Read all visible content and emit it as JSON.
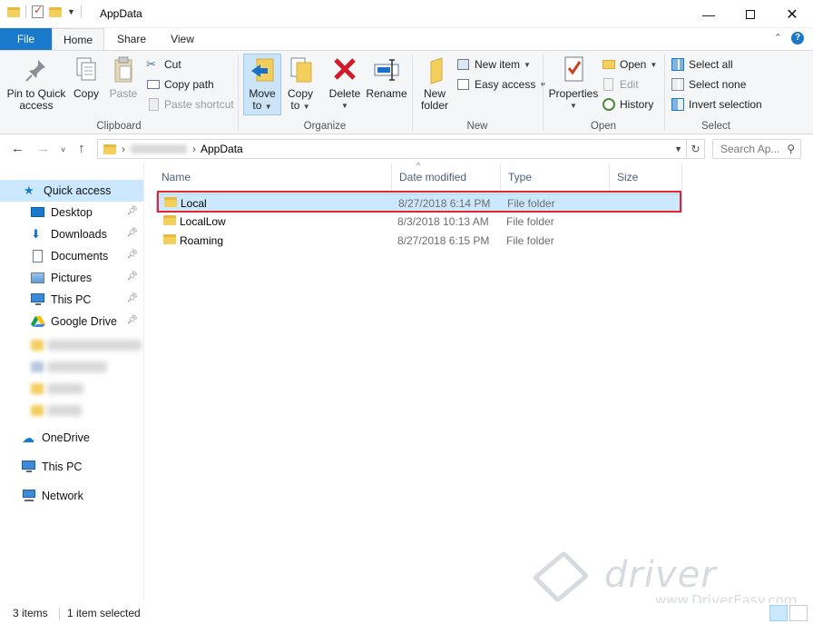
{
  "window": {
    "title": "AppData"
  },
  "ribbon_tabs": {
    "file": "File",
    "home": "Home",
    "share": "Share",
    "view": "View"
  },
  "clipboard": {
    "label": "Clipboard",
    "pin_line1": "Pin to Quick",
    "pin_line2": "access",
    "copy": "Copy",
    "paste": "Paste",
    "cut": "Cut",
    "copy_path": "Copy path",
    "paste_shortcut": "Paste shortcut"
  },
  "organize": {
    "label": "Organize",
    "move_line1": "Move",
    "move_line2": "to",
    "copy_line1": "Copy",
    "copy_line2": "to",
    "delete": "Delete",
    "rename": "Rename"
  },
  "new": {
    "label": "New",
    "folder_line1": "New",
    "folder_line2": "folder",
    "new_item": "New item",
    "easy_access": "Easy access"
  },
  "open": {
    "label": "Open",
    "properties": "Properties",
    "open": "Open",
    "edit": "Edit",
    "history": "History"
  },
  "select": {
    "label": "Select",
    "select_all": "Select all",
    "select_none": "Select none",
    "invert": "Invert selection"
  },
  "address": {
    "current": "AppData"
  },
  "search": {
    "placeholder": "Search Ap..."
  },
  "sidebar": {
    "quick_access": "Quick access",
    "items": [
      {
        "label": "Desktop"
      },
      {
        "label": "Downloads"
      },
      {
        "label": "Documents"
      },
      {
        "label": "Pictures"
      },
      {
        "label": "This PC"
      },
      {
        "label": "Google Drive"
      }
    ],
    "onedrive": "OneDrive",
    "this_pc": "This PC",
    "network": "Network"
  },
  "columns": {
    "name": "Name",
    "date": "Date modified",
    "type": "Type",
    "size": "Size"
  },
  "files": [
    {
      "name": "Local",
      "date": "8/27/2018 6:14 PM",
      "type": "File folder",
      "selected": true
    },
    {
      "name": "LocalLow",
      "date": "8/3/2018 10:13 AM",
      "type": "File folder",
      "selected": false
    },
    {
      "name": "Roaming",
      "date": "8/27/2018 6:15 PM",
      "type": "File folder",
      "selected": false
    }
  ],
  "status": {
    "count": "3 items",
    "selected": "1 item selected"
  },
  "watermark": {
    "brand": "driver easy",
    "url": "www.DriverEasy.com"
  },
  "colors": {
    "accent": "#1979ca",
    "selection": "#cce8ff",
    "highlight_box": "#e3262d",
    "folder": "#f3cf5d"
  }
}
